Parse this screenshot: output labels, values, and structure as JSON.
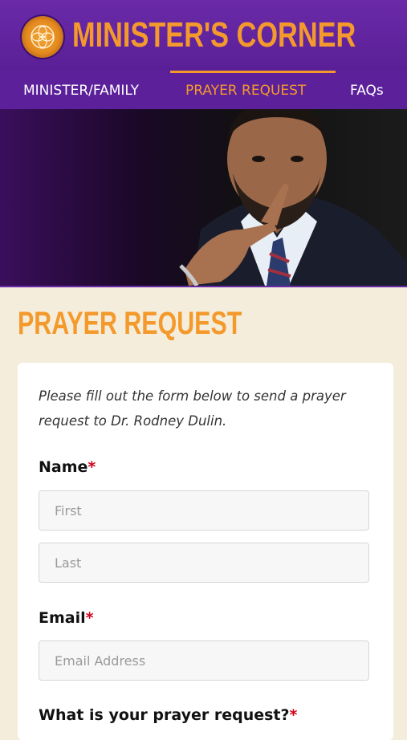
{
  "header": {
    "title": "MINISTER'S CORNER",
    "logo_icon": "church-seal-logo"
  },
  "nav": {
    "items": [
      {
        "label": "MINISTER/FAMILY",
        "active": false
      },
      {
        "label": "PRAYER REQUEST",
        "active": true
      },
      {
        "label": "FAQs",
        "active": false
      }
    ]
  },
  "hero": {
    "image": "minister-portrait"
  },
  "page": {
    "title": "PRAYER REQUEST"
  },
  "form": {
    "intro": "Please fill out the form below to send a prayer request to Dr. Rodney Dulin.",
    "name_label": "Name",
    "first_placeholder": "First",
    "last_placeholder": "Last",
    "email_label": "Email",
    "email_placeholder": "Email Address",
    "request_label": "What is your prayer request?",
    "required_mark": "*"
  },
  "colors": {
    "header_purple": "#5b209a",
    "accent_orange": "#f49a2c",
    "page_bg": "#f4eddc",
    "required_red": "#d0021b"
  }
}
